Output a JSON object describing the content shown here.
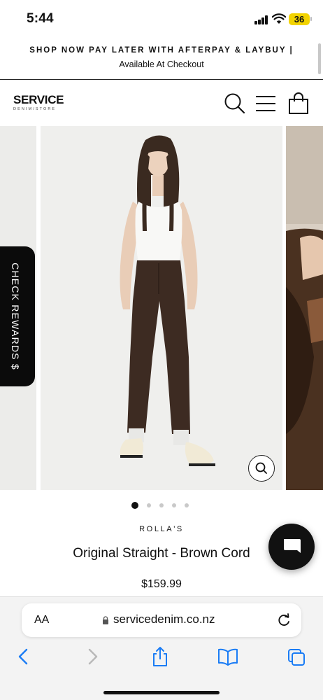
{
  "status_bar": {
    "time": "5:44",
    "battery": "36"
  },
  "announcement": {
    "line1": "SHOP NOW PAY LATER WITH AFTERPAY & LAYBUY |",
    "line2": "Available At Checkout"
  },
  "header": {
    "logo_main": "SERVICE",
    "logo_sub": "DENIM/STORE",
    "icons": [
      "search-icon",
      "menu-icon",
      "bag-icon"
    ]
  },
  "gallery": {
    "slide_count": 5,
    "active_index": 0
  },
  "rewards": {
    "label": "CHECK REWARDS $"
  },
  "product": {
    "vendor": "ROLLA'S",
    "title": "Original Straight - Brown Cord",
    "price": "$159.99"
  },
  "safari": {
    "aa_label": "AA",
    "url": "servicedenim.co.nz",
    "toolbar": [
      "back-icon",
      "forward-icon",
      "share-icon",
      "bookmarks-icon",
      "tabs-icon"
    ]
  },
  "colors": {
    "rewards_bg": "#0b0b0b",
    "battery": "#f2d300",
    "safari_blue": "#1a7cf5",
    "pants": "#3d2b22"
  }
}
